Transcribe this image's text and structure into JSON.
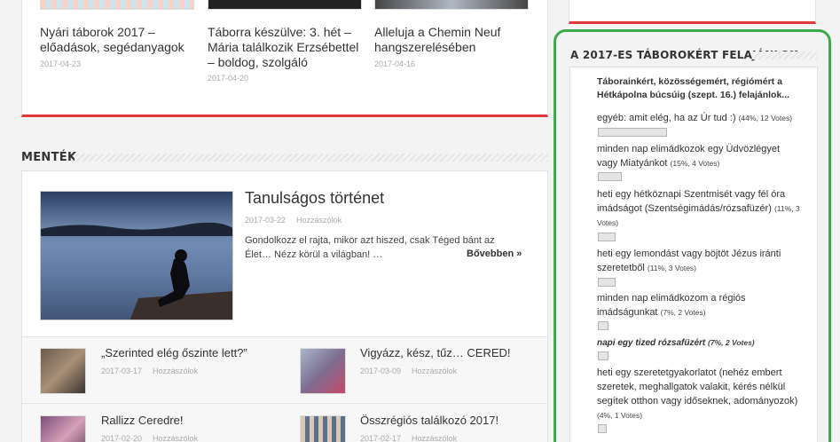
{
  "top_posts": [
    {
      "title": "Nyári táborok 2017 – előadások, segédanyagok",
      "date": "2017-04-23"
    },
    {
      "title": "Táborra készülve: 3. hét – Mária találkozik Erzsébettel – boldog, szolgáló",
      "date": "2017-04-20"
    },
    {
      "title": "Alleluja a Chemin Neuf hangszerelésében",
      "date": "2017-04-16"
    }
  ],
  "section": {
    "title": "MENTÉK"
  },
  "featured": {
    "title": "Tanulságos történet",
    "date": "2017-03-22",
    "comments": "Hozzászólok",
    "excerpt": "Gondolkozz el rajta, mikor azt hiszed, csak Téged bánt az Élet… Nézz körül a világban! …",
    "more": "Bővebben »"
  },
  "list_posts": [
    {
      "title": "„Szerinted elég őszinte lett?”",
      "date": "2017-03-17",
      "comments": "Hozzászólok"
    },
    {
      "title": "Vigyázz, kész, tűz… CERED!",
      "date": "2017-03-09",
      "comments": "Hozzászólok"
    },
    {
      "title": "Rallizz Ceredre!",
      "date": "2017-02-20",
      "comments": "Hozzászólok"
    },
    {
      "title": "Összrégiós találkozó 2017!",
      "date": "2017-02-17",
      "comments": "Hozzászólok"
    }
  ],
  "poll": {
    "heading": "A 2017-ES TÁBOROKÉRT FELAJÁNLOK",
    "question": "Táborainkért, közösségemért, régiómért a Hétkápolna búcsúig (szept. 16.) felajánlok...",
    "options": [
      {
        "text": "egyéb: amit elég, ha az Úr tud :)",
        "stats": "(44%, 12 Votes)",
        "percent": 44
      },
      {
        "text": "minden nap elimádkozok egy Üdvözlégyet vagy Miatyánkot",
        "stats": "(15%, 4 Votes)",
        "percent": 15
      },
      {
        "text": "heti egy hétköznapi Szentmisét vagy fél óra imádságot (Szentségimádás/rózsafüzér)",
        "stats": "(11%, 3 Votes)",
        "percent": 11
      },
      {
        "text": "heti egy lemondást vagy böjtöt Jézus iránti szeretetből",
        "stats": "(11%, 3 Votes)",
        "percent": 11
      },
      {
        "text": "minden nap elimádkozom a régiós imádságunkat",
        "stats": "(7%, 2 Votes)",
        "percent": 7
      },
      {
        "text": "napi egy tized rózsafüzért",
        "stats": "(7%, 2 Votes)",
        "percent": 7
      },
      {
        "text": "heti egy szeretetgyakorlatot (nehéz embert szeretek, meghallgatok valakit, kérés nélkül segítek otthon vagy időseknek, adományozok)",
        "stats": "(4%, 1 Votes)",
        "percent": 4
      }
    ]
  },
  "colors": {
    "accent_red": "#e0383c",
    "poll_border_green": "#3aaa4a"
  }
}
